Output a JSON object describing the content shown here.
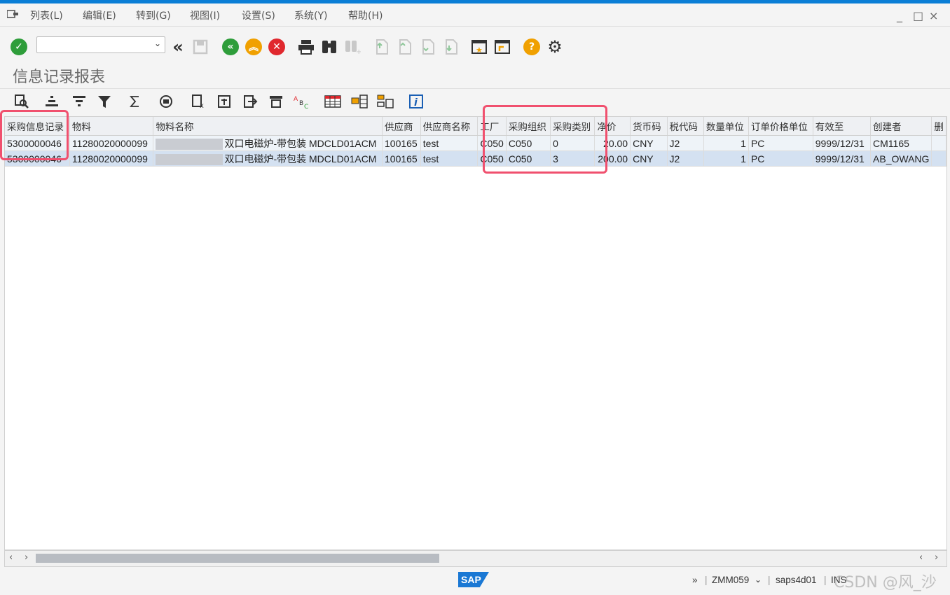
{
  "menubar": {
    "items": [
      "列表(L)",
      "编辑(E)",
      "转到(G)",
      "视图(I)",
      "设置(S)",
      "系统(Y)",
      "帮助(H)"
    ]
  },
  "window_controls": {
    "minimize": "_",
    "maximize": "□",
    "close": "×"
  },
  "toolbar": {
    "command_field_value": "",
    "icons": [
      "enter-icon",
      "back-double-icon",
      "save-icon",
      "back-icon",
      "exit-icon",
      "cancel-icon",
      "print-icon",
      "find-icon",
      "find-next-icon",
      "first-page-icon",
      "prev-page-icon",
      "next-page-icon",
      "last-page-icon",
      "new-session-icon",
      "shortcut-icon",
      "help-icon",
      "settings-icon"
    ]
  },
  "page": {
    "title": "信息记录报表"
  },
  "alv_toolbar": {
    "icons": [
      "details-icon",
      "sort-asc-icon",
      "sort-desc-icon",
      "filter-icon",
      "sum-icon",
      "subtotal-icon",
      "print-preview-icon",
      "export-icon",
      "send-icon",
      "layout-icon",
      "abc-analysis-icon",
      "views-icon",
      "graphics-icon",
      "layout-select-icon",
      "info-icon"
    ]
  },
  "grid": {
    "columns": [
      "采购信息记录",
      "物料",
      "物料名称",
      "供应商",
      "供应商名称",
      "工厂",
      "采购组织",
      "采购类别",
      "净价",
      "货币码",
      "税代码",
      "数量单位",
      "订单价格单位",
      "有效至",
      "创建者",
      "删"
    ],
    "rows": [
      [
        "5300000046",
        "11280020000099",
        "双口电磁炉-带包装 MDCLD01ACM",
        "100165",
        "test",
        "C050",
        "C050",
        "0",
        "20.00",
        "CNY",
        "J2",
        "1",
        "PC",
        "9999/12/31",
        "CM1165",
        ""
      ],
      [
        "5300000046",
        "11280020000099",
        "双口电磁炉-带包装 MDCLD01ACM",
        "100165",
        "test",
        "C050",
        "C050",
        "3",
        "200.00",
        "CNY",
        "J2",
        "1",
        "PC",
        "9999/12/31",
        "AB_OWANG",
        ""
      ]
    ]
  },
  "statusbar": {
    "logo": "SAP",
    "expand": "»",
    "transaction": "ZMM059",
    "separator": "|",
    "system": "saps4d01",
    "mode": "INS",
    "watermark": "CSDN @风_沙"
  },
  "colors": {
    "accent": "#0a7ed6",
    "highlight": "#f0506e",
    "selected_row": "#d4e1f1"
  }
}
